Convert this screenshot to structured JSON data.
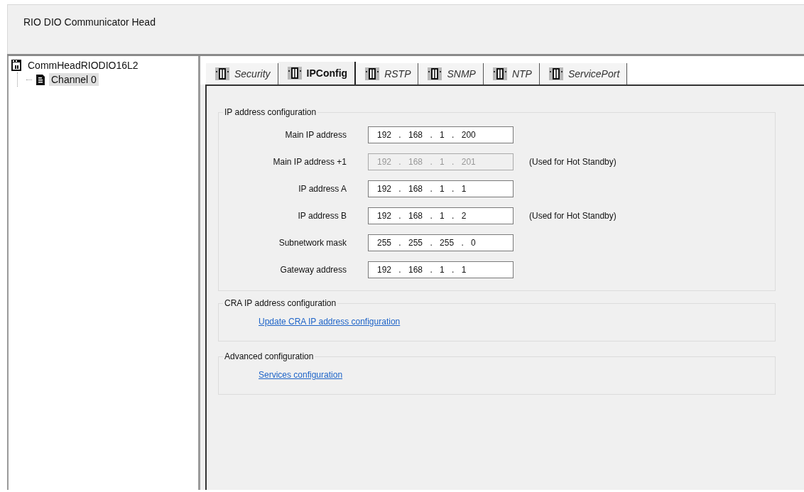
{
  "window": {
    "title": "RIO DIO Communicator Head"
  },
  "tree": {
    "items": [
      {
        "label": "CommHeadRIODIO16L2",
        "selected": false,
        "children": [
          {
            "label": "Channel 0",
            "selected": true
          }
        ]
      }
    ]
  },
  "tabs": [
    {
      "label": "Security",
      "selected": false
    },
    {
      "label": "IPConfig",
      "selected": true
    },
    {
      "label": "RSTP",
      "selected": false
    },
    {
      "label": "SNMP",
      "selected": false
    },
    {
      "label": "NTP",
      "selected": false
    },
    {
      "label": "ServicePort",
      "selected": false
    }
  ],
  "ip_group": {
    "title": "IP address configuration",
    "rows": [
      {
        "label": "Main IP address",
        "value": "192 . 168 . 1 . 200",
        "disabled": false
      },
      {
        "label": "Main IP address +1",
        "value": "192 . 168 . 1 . 201",
        "disabled": true,
        "note": "(Used for Hot Standby)"
      },
      {
        "label": "IP address A",
        "value": "192 . 168 . 1 . 1",
        "disabled": false
      },
      {
        "label": "IP address B",
        "value": "192 . 168 . 1 . 2",
        "disabled": false,
        "note": "(Used for Hot Standby)"
      },
      {
        "label": "Subnetwork mask",
        "value": "255 . 255 . 255 . 0",
        "disabled": false
      },
      {
        "label": "Gateway address",
        "value": "192 . 168 . 1 . 1",
        "disabled": false
      }
    ]
  },
  "link_groups": [
    {
      "title": "CRA IP address configuration",
      "link": "Update CRA IP address configuration"
    },
    {
      "title": "Advanced configuration",
      "link": "Services configuration"
    }
  ]
}
